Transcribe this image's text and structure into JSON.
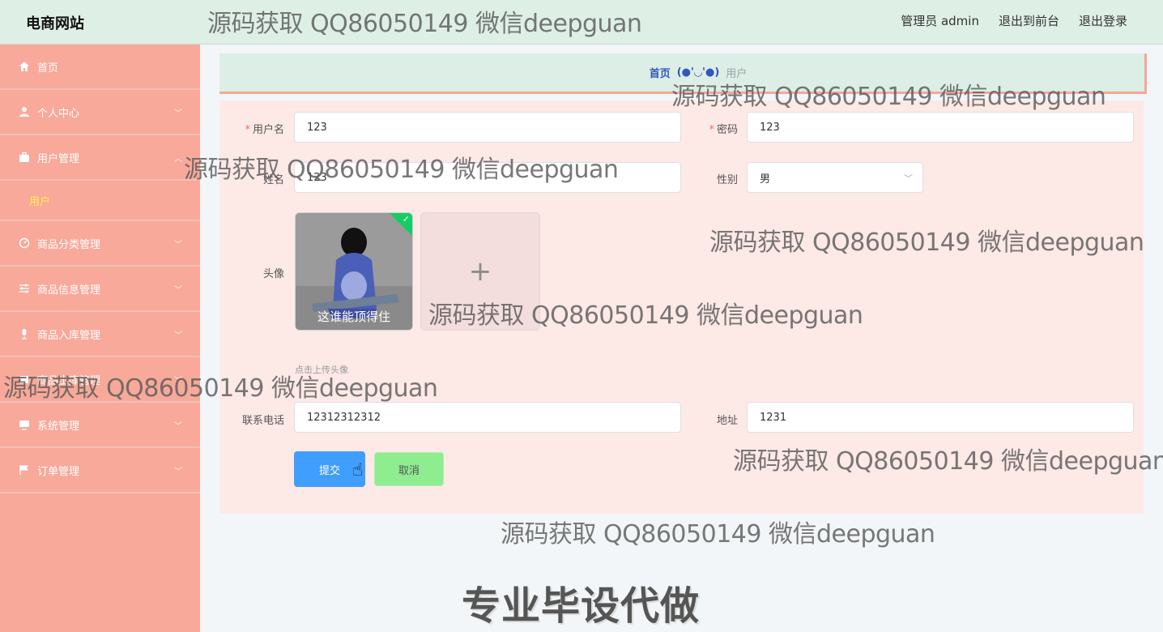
{
  "header": {
    "brand": "电商网站",
    "admin": "管理员 admin",
    "to_front": "退出到前台",
    "logout": "退出登录"
  },
  "sidebar": {
    "items": [
      {
        "label": "首页",
        "icon": "home-icon"
      },
      {
        "label": "个人中心",
        "icon": "user-icon"
      },
      {
        "label": "用户管理",
        "icon": "briefcase-icon"
      },
      {
        "label": "商品分类管理",
        "icon": "dashboard-icon"
      },
      {
        "label": "商品信息管理",
        "icon": "sliders-icon"
      },
      {
        "label": "商品入库管理",
        "icon": "mic-icon"
      },
      {
        "label": "商品出库管理",
        "icon": "box-icon"
      },
      {
        "label": "系统管理",
        "icon": "monitor-icon"
      },
      {
        "label": "订单管理",
        "icon": "flag-icon"
      }
    ],
    "sub_item": "用户"
  },
  "breadcrumb": {
    "home": "首页",
    "face": "(●'◡'●)",
    "current": "用户"
  },
  "form": {
    "username_label": "用户名",
    "username_value": "123",
    "password_label": "密码",
    "password_value": "123",
    "name_label": "姓名",
    "name_value": "123",
    "gender_label": "性别",
    "gender_value": "男",
    "avatar_label": "头像",
    "avatar_caption": "这谁能顶得住",
    "upload_hint": "点击上传头像",
    "phone_label": "联系电话",
    "phone_value": "12312312312",
    "address_label": "地址",
    "address_value": "1231",
    "submit": "提交",
    "cancel": "取消"
  },
  "watermark": {
    "text": "源码获取 QQ86050149 微信deepguan",
    "banner": "专业毕设代做"
  },
  "colors": {
    "header_bg": "#deefe6",
    "sidebar_bg": "#f8a99a",
    "submenu_active": "#fff44f",
    "panel_bg": "#fde9e5",
    "primary": "#409eff",
    "cancel": "#8ded8f"
  }
}
